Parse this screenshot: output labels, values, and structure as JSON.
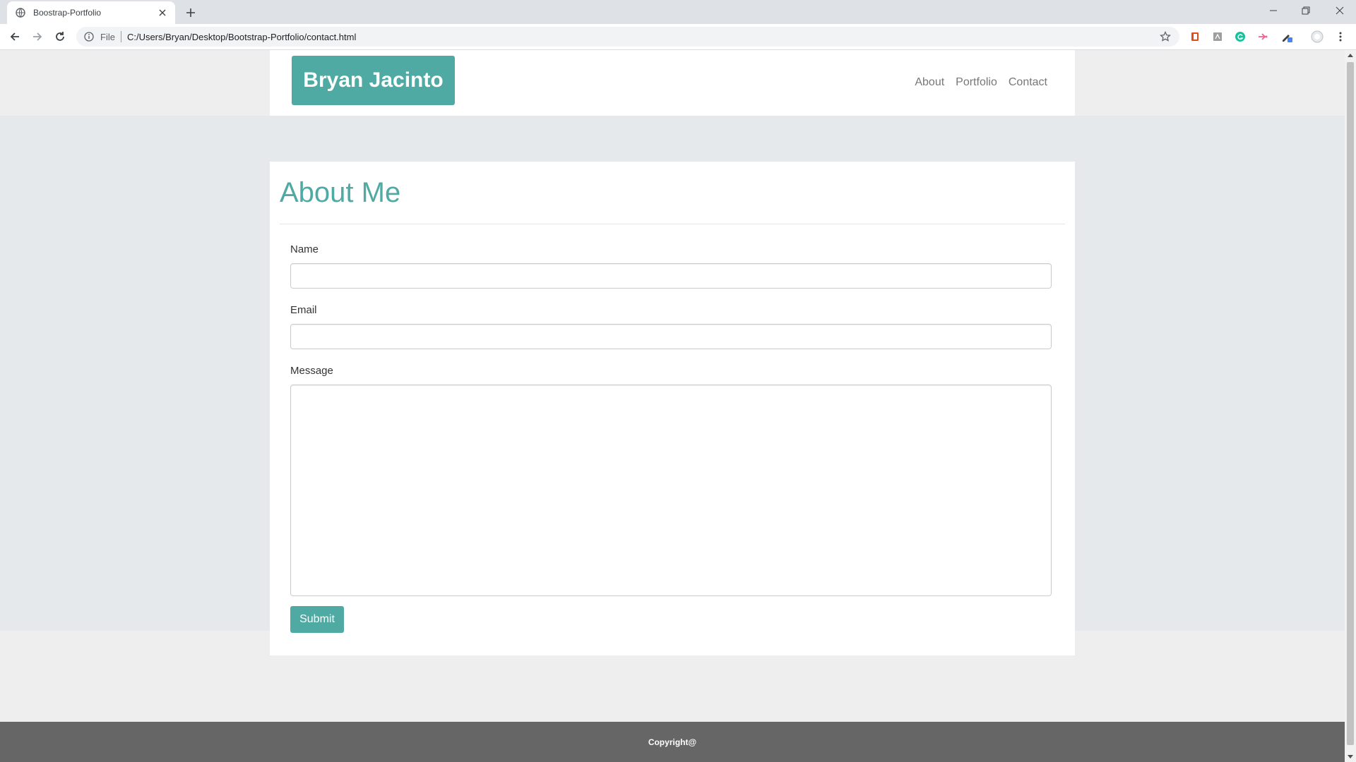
{
  "browser": {
    "tab_title": "Boostrap-Portfolio",
    "address_prefix": "File",
    "url": "C:/Users/Bryan/Desktop/Bootstrap-Portfolio/contact.html"
  },
  "navbar": {
    "brand": "Bryan Jacinto",
    "links": [
      "About",
      "Portfolio",
      "Contact"
    ]
  },
  "main": {
    "heading": "About Me",
    "form": {
      "name_label": "Name",
      "name_value": "",
      "email_label": "Email",
      "email_value": "",
      "message_label": "Message",
      "message_value": "",
      "submit_label": "Submit"
    }
  },
  "footer": {
    "text": "Copyright@"
  },
  "colors": {
    "accent": "#4eaaa3",
    "footer_bg": "#666666",
    "page_bg": "#eeeeee",
    "band_bg": "#e6e9ec"
  },
  "icons": [
    "globe-icon",
    "close-icon",
    "plus-icon",
    "minimize-icon",
    "restore-icon",
    "back-icon",
    "forward-icon",
    "reload-icon",
    "info-icon",
    "star-icon",
    "office-extension-icon",
    "pdf-extension-icon",
    "grammarly-icon",
    "cast-extension-icon",
    "pen-extension-icon",
    "profile-icon",
    "menu-icon"
  ]
}
